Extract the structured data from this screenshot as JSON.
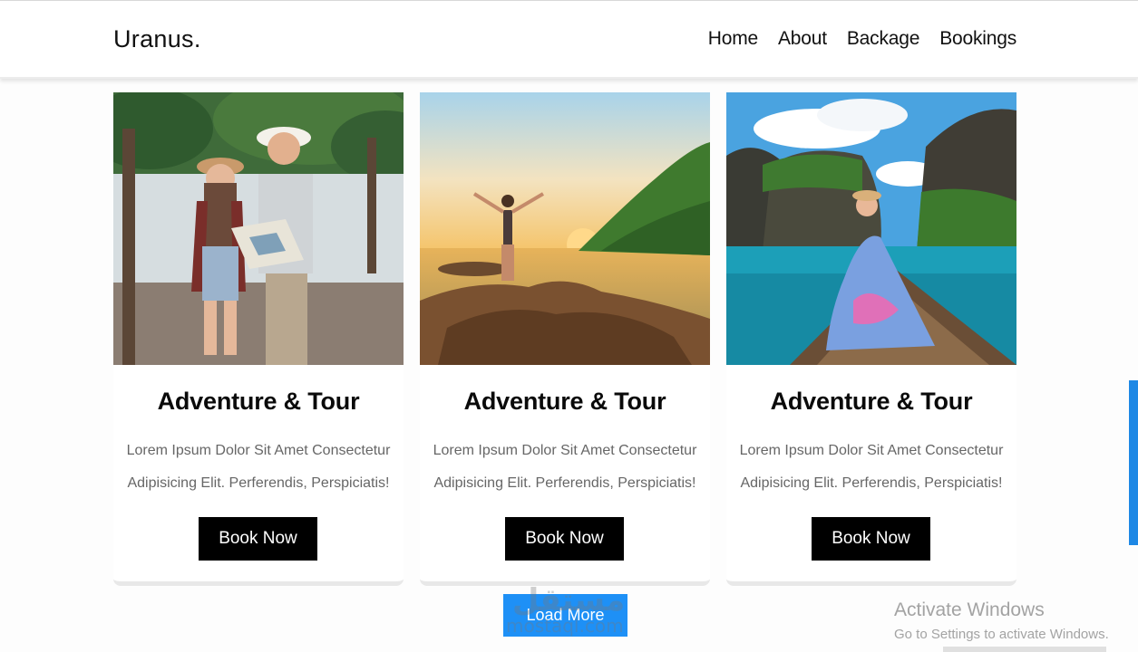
{
  "header": {
    "logo": "Uranus.",
    "nav": [
      {
        "label": "Home"
      },
      {
        "label": "About"
      },
      {
        "label": "Backage"
      },
      {
        "label": "Bookings"
      }
    ]
  },
  "cards": [
    {
      "title": "Adventure & Tour",
      "description_line1": "Lorem Ipsum Dolor Sit Amet Consectetur",
      "description_line2": "Adipisicing Elit. Perferendis, Perspiciatis!",
      "button": "Book Now"
    },
    {
      "title": "Adventure & Tour",
      "description_line1": "Lorem Ipsum Dolor Sit Amet Consectetur",
      "description_line2": "Adipisicing Elit. Perferendis, Perspiciatis!",
      "button": "Book Now"
    },
    {
      "title": "Adventure & Tour",
      "description_line1": "Lorem Ipsum Dolor Sit Amet Consectetur",
      "description_line2": "Adipisicing Elit. Perferendis, Perspiciatis!",
      "button": "Book Now"
    }
  ],
  "load_more": "Load More",
  "watermark": {
    "arabic": "مستقل",
    "latin": "mostaql.com"
  },
  "os_notice": {
    "title": "Activate Windows",
    "subtitle": "Go to Settings to activate Windows."
  },
  "colors": {
    "accent": "#1e90f6",
    "button_dark": "#000000",
    "scrollbar": "#1e88e5"
  }
}
